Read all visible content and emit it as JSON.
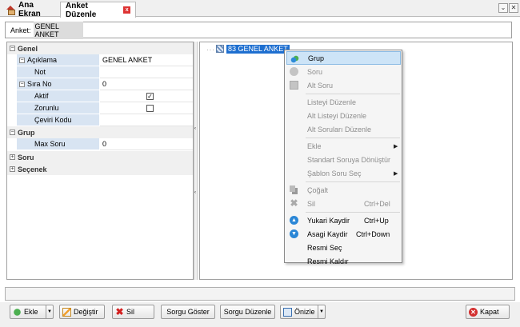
{
  "tabs": [
    {
      "label": "Ana Ekran"
    },
    {
      "label": "Anket Düzenle"
    }
  ],
  "anket": {
    "label": "Anket:",
    "value": "GENEL ANKET"
  },
  "property_grid": {
    "genel": {
      "label": "Genel"
    },
    "aciklama": {
      "label": "Açıklama",
      "value": "GENEL ANKET"
    },
    "not": {
      "label": "Not",
      "value": ""
    },
    "sira_no": {
      "label": "Sıra No",
      "value": "0"
    },
    "aktif": {
      "label": "Aktif",
      "checked": true
    },
    "zorunlu": {
      "label": "Zorunlu",
      "checked": false
    },
    "ceviri_kodu": {
      "label": "Çeviri Kodu",
      "value": ""
    },
    "grup": {
      "label": "Grup"
    },
    "max_soru": {
      "label": "Max Soru",
      "value": "0"
    },
    "soru": {
      "label": "Soru"
    },
    "secenek": {
      "label": "Seçenek"
    }
  },
  "tree": {
    "node_label": "83 GENEL ANKET"
  },
  "context_menu": {
    "items": [
      {
        "label": "Grup",
        "shortcut": "",
        "icon": "group-icon"
      },
      {
        "label": "Soru",
        "shortcut": "",
        "icon": "question-icon"
      },
      {
        "label": "Alt Soru",
        "shortcut": "",
        "icon": "subquestion-icon"
      },
      {
        "label": "Listeyi Düzenle",
        "shortcut": ""
      },
      {
        "label": "Alt Listeyi Düzenle",
        "shortcut": ""
      },
      {
        "label": "Alt Soruları Düzenle",
        "shortcut": ""
      },
      {
        "label": "Ekle",
        "shortcut": ""
      },
      {
        "label": "Standart Soruya Dönüştür",
        "shortcut": ""
      },
      {
        "label": "Şablon Soru Seç",
        "shortcut": ""
      },
      {
        "label": "Çoğalt",
        "shortcut": "",
        "icon": "copy-icon"
      },
      {
        "label": "Sil",
        "shortcut": "Ctrl+Del",
        "icon": "delete-icon"
      },
      {
        "label": "Yukari Kaydir",
        "shortcut": "Ctrl+Up",
        "icon": "arrow-up-icon"
      },
      {
        "label": "Asagi Kaydir",
        "shortcut": "Ctrl+Down",
        "icon": "arrow-down-icon"
      },
      {
        "label": "Resmi Seç",
        "shortcut": ""
      },
      {
        "label": "Resmi Kaldır",
        "shortcut": ""
      }
    ]
  },
  "toolbar": {
    "ekle": "Ekle",
    "degistir": "Değiştir",
    "sil": "Sil",
    "sorgu_goster": "Sorgu Göster",
    "sorgu_duzenle": "Sorgu Düzenle",
    "onizle": "Önizle",
    "kapat": "Kapat"
  },
  "colors": {
    "accent": "#1e6fd0",
    "highlight": "#cde4f7",
    "property_name_bg": "#d8e4f2",
    "close_red": "#d32f2f"
  }
}
